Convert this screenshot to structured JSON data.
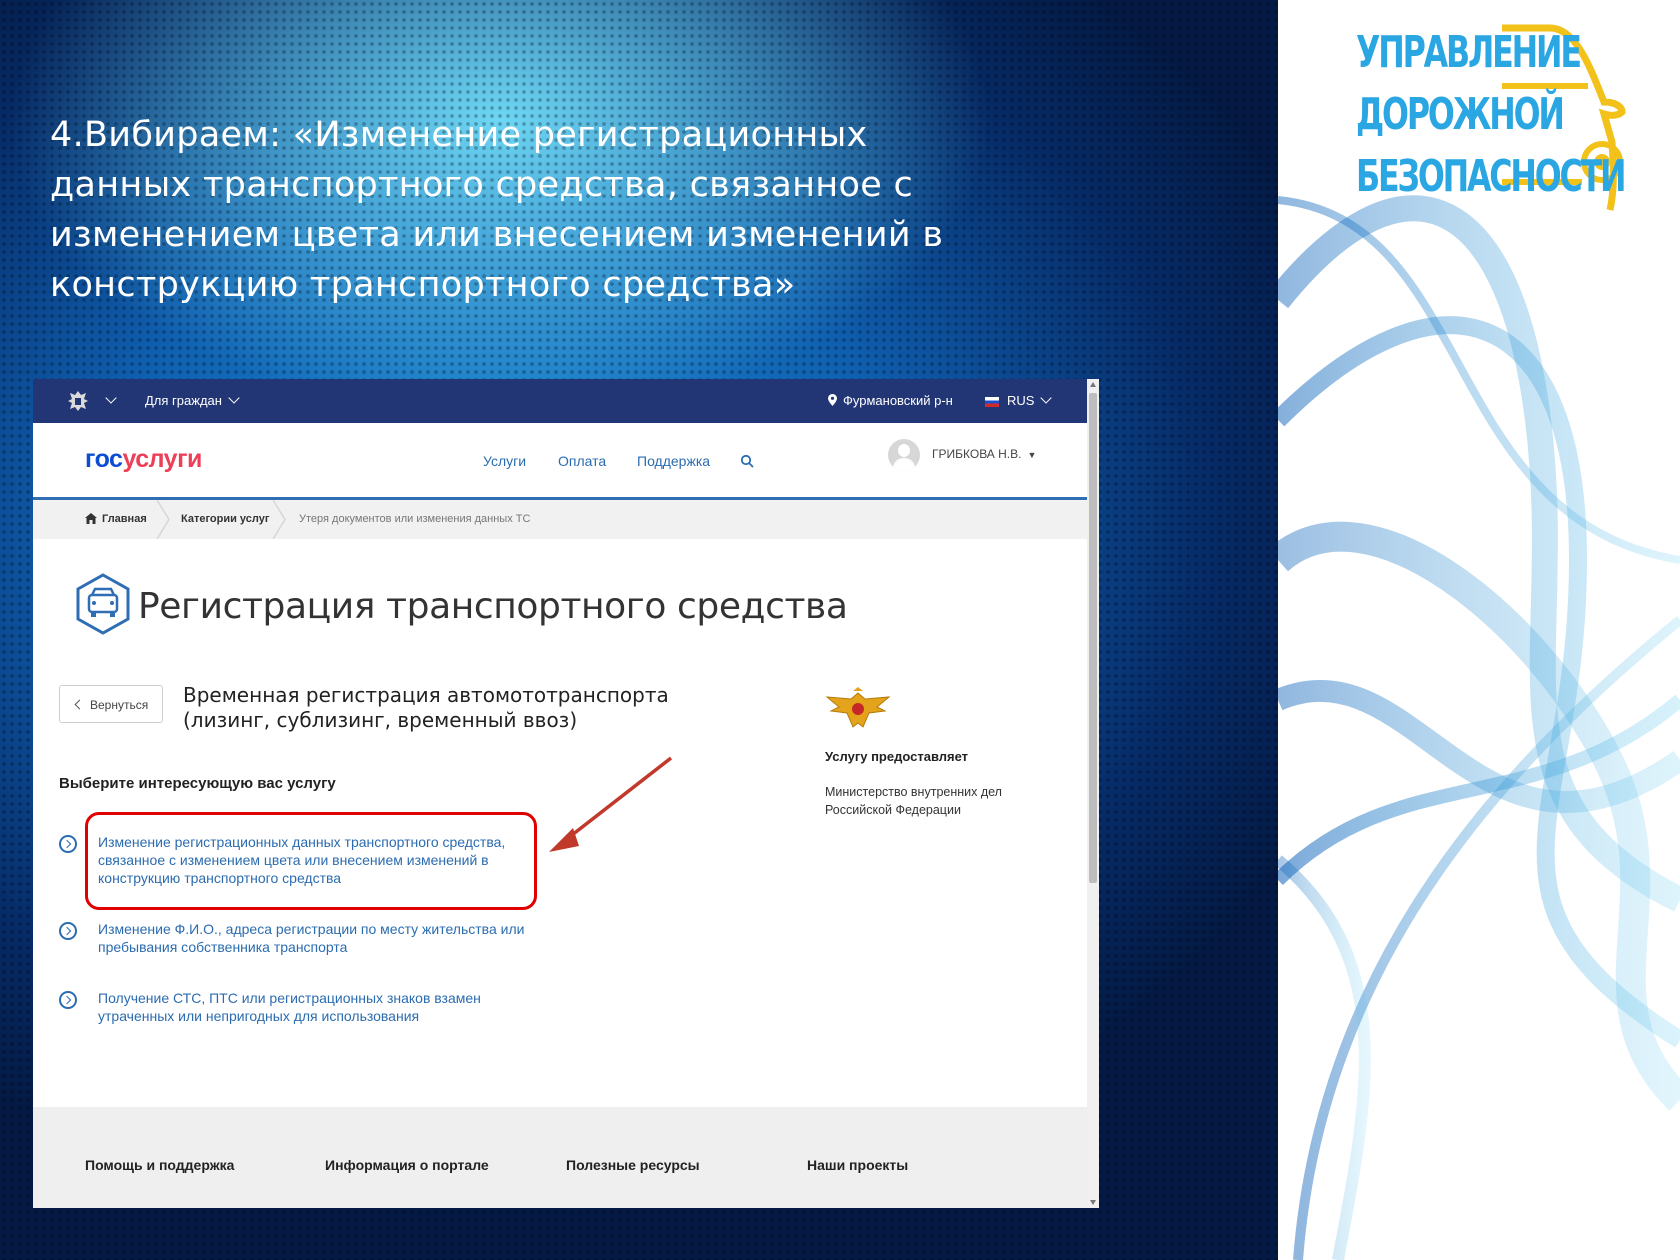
{
  "slide": {
    "title": "4.Вибираем:  «Изменение регистрационных данных транспортного средства, связанное с изменением цвета или внесением изменений в конструкцию транспортного средства»",
    "logo_lines": [
      "УПРАВЛЕНИЕ",
      "ДОРОЖНОЙ",
      "БЕЗОПАСНОСТИ"
    ],
    "colors": {
      "logo_text": "#2aa6e3",
      "logo_car": "#f2c21a",
      "bg_dark": "#062a66",
      "bg_light": "#5fd6f5"
    }
  },
  "browser": {
    "topbar": {
      "emblem_icon": "coat-of-arms-icon",
      "citizens_label": "Для граждан",
      "location_label": "Фурмановский р-н",
      "language_label": "RUS"
    },
    "header": {
      "brand_part1": "гос",
      "brand_part2": "услуги",
      "nav": {
        "services": "Услуги",
        "payment": "Оплата",
        "support": "Поддержка"
      },
      "user_name": "ГРИБКОВА Н.В."
    },
    "breadcrumbs": [
      "Главная",
      "Категории услуг",
      "Утеря документов или изменения данных ТС"
    ],
    "page_title": "Регистрация транспортного средства",
    "back_label": "Вернуться",
    "service_title": "Временная регистрация автомототранспорта (лизинг, сублизинг, временный ввоз)",
    "choose_label": "Выберите интересующую вас услугу",
    "options": [
      "Изменение регистрационных данных транспортного средства, связанное с изменением цвета или внесением изменений в конструкцию транспортного средства",
      "Изменение Ф.И.О., адреса регистрации по месту жительства или пребывания собственника транспорта",
      "Получение СТС, ПТС или регистрационных знаков взамен утраченных или непригодных для использования"
    ],
    "provider": {
      "label": "Услугу предоставляет",
      "value": "Министерство внутренних дел Российской Федерации"
    },
    "footer": [
      "Помощь и поддержка",
      "Информация о портале",
      "Полезные ресурсы",
      "Наши проекты"
    ],
    "colors": {
      "topbar": "#223675",
      "link": "#2b6cb0",
      "highlight": "#e00000"
    }
  }
}
